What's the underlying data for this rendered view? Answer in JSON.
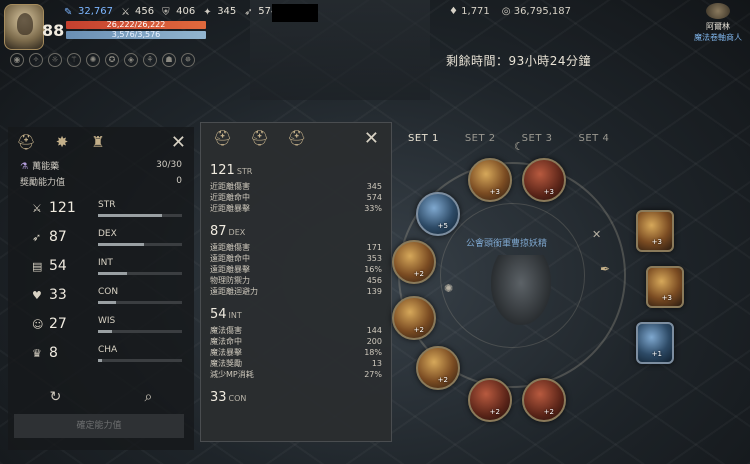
{
  "hud": {
    "level": "88",
    "stats": [
      {
        "icon": "blue-feather-icon",
        "value": "32,767",
        "highlight": true
      },
      {
        "icon": "stat-icon-2",
        "value": "456",
        "highlight": false
      },
      {
        "icon": "stat-icon-3",
        "value": "406",
        "highlight": false
      },
      {
        "icon": "stat-icon-4",
        "value": "345",
        "highlight": false
      },
      {
        "icon": "stat-icon-5",
        "value": "574",
        "highlight": false
      }
    ],
    "hp": "26,222/26,222",
    "mp": "3,576/3,576",
    "currency": [
      {
        "icon": "diamond-icon",
        "value": "1,771"
      },
      {
        "icon": "coin-icon",
        "value": "36,795,187"
      }
    ],
    "npc_name": "阿爾林",
    "npc_title": "魔法卷軸商人",
    "timer": "剩餘時間：93小時24分鐘"
  },
  "left_panel": {
    "potion_label": "萬能藥",
    "potion_value": "30/30",
    "bonus_label": "獎勵能力值",
    "bonus_value": "0",
    "stats": [
      {
        "icon": "sword-icon",
        "value": "121",
        "label": "STR",
        "fill": 0.76
      },
      {
        "icon": "bow-icon",
        "value": "87",
        "label": "DEX",
        "fill": 0.55
      },
      {
        "icon": "book-icon",
        "value": "54",
        "label": "INT",
        "fill": 0.34
      },
      {
        "icon": "heart-icon",
        "value": "33",
        "label": "CON",
        "fill": 0.21
      },
      {
        "icon": "head-icon",
        "value": "27",
        "label": "WIS",
        "fill": 0.17
      },
      {
        "icon": "crown-icon",
        "value": "8",
        "label": "CHA",
        "fill": 0.05
      }
    ],
    "confirm_label": "確定能力值"
  },
  "tooltip": {
    "sections": [
      {
        "value": "121",
        "label": "STR",
        "rows": [
          [
            "近距離傷害",
            "345"
          ],
          [
            "近距離命中",
            "574"
          ],
          [
            "近距離暴擊",
            "33%"
          ]
        ]
      },
      {
        "value": "87",
        "label": "DEX",
        "rows": [
          [
            "遠距離傷害",
            "171"
          ],
          [
            "遠距離命中",
            "353"
          ],
          [
            "遠距離暴擊",
            "16%"
          ],
          [
            "物理防禦力",
            "456"
          ],
          [
            "遠距離迴避力",
            "139"
          ]
        ]
      },
      {
        "value": "54",
        "label": "INT",
        "rows": [
          [
            "魔法傷害",
            "144"
          ],
          [
            "魔法命中",
            "200"
          ],
          [
            "魔法暴擊",
            "18%"
          ],
          [
            "魔法獎勵",
            "13"
          ],
          [
            "減少MP消耗",
            "27%"
          ]
        ]
      },
      {
        "value": "33",
        "label": "CON",
        "rows": []
      }
    ]
  },
  "sets": {
    "tabs": [
      "SET 1",
      "SET 2",
      "SET 3",
      "SET 4"
    ],
    "active": 0,
    "center_label": "公會頭銜軍曹掠妖精"
  },
  "colors": {
    "accent": "#c4b08a",
    "hp": "#c5402f",
    "mp": "#6a8fb4",
    "link": "#7fb4ea"
  }
}
